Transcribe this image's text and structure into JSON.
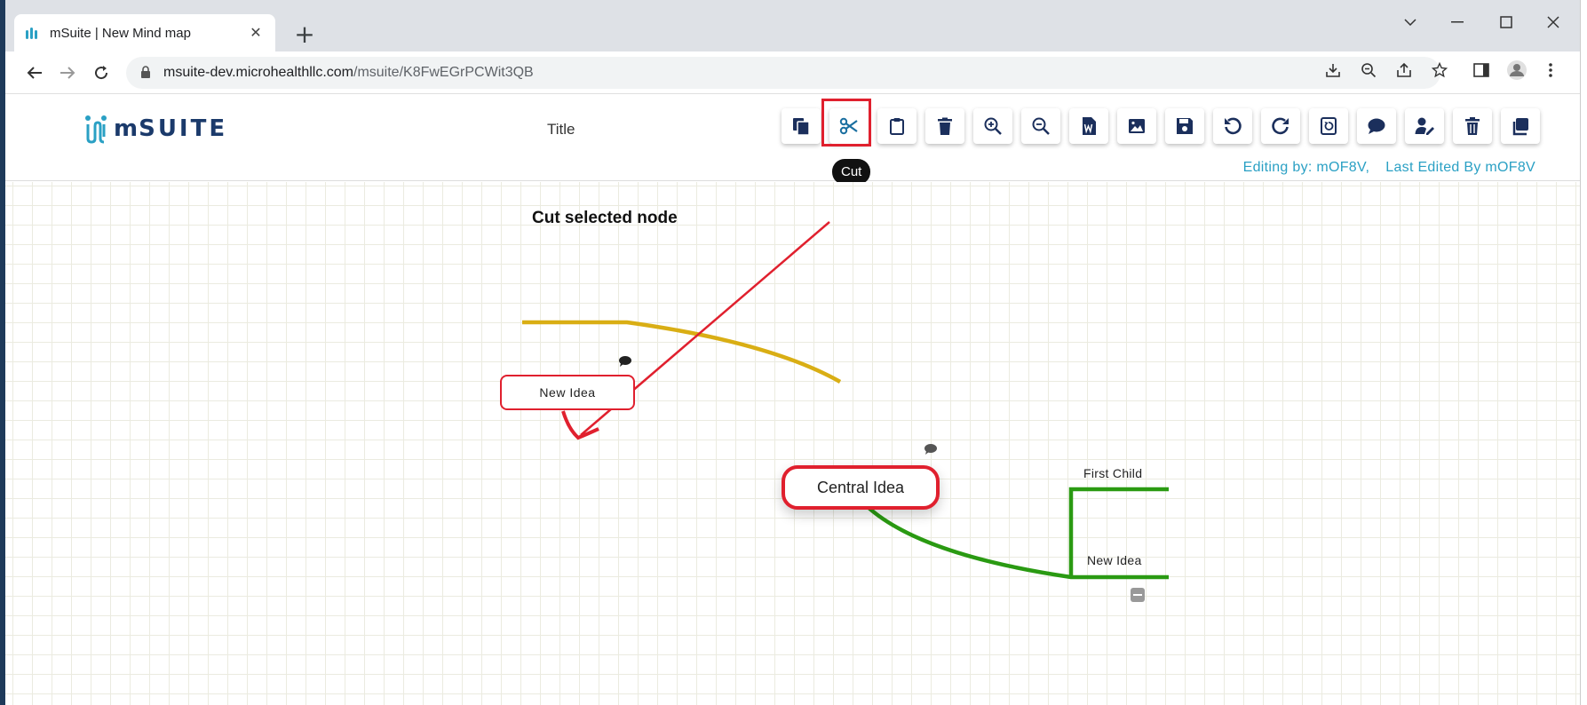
{
  "browser": {
    "tab_title": "mSuite | New Mind map",
    "url_host": "msuite-dev.microhealthllc.com",
    "url_path": "/msuite/K8FwEGrPCWit3QB"
  },
  "app": {
    "logo_prefix": "m",
    "logo_text": "SUITE",
    "title": "Title",
    "toolbar": [
      "copy-icon",
      "cut-icon",
      "paste-icon",
      "delete-node-icon",
      "zoom-in-icon",
      "zoom-out-icon",
      "word-export-icon",
      "image-export-icon",
      "save-icon",
      "undo-icon",
      "redo-icon",
      "reset-icon",
      "comment-icon",
      "user-edit-icon",
      "trash-icon",
      "duplicate-icon"
    ],
    "tooltip": "Cut",
    "editing_by": "Editing by: mOF8V,",
    "last_edited": "Last Edited By mOF8V"
  },
  "canvas": {
    "annotation": "Cut selected node",
    "nodes": {
      "selected": "New Idea",
      "central": "Central Idea",
      "child_one": "First Child",
      "child_two": "New Idea"
    }
  },
  "colors": {
    "accent": "#2aa0c4",
    "brand": "#1b3a6b",
    "highlight": "#e0202e",
    "branch_yellow": "#d9ae14",
    "branch_green": "#2a9a12"
  }
}
